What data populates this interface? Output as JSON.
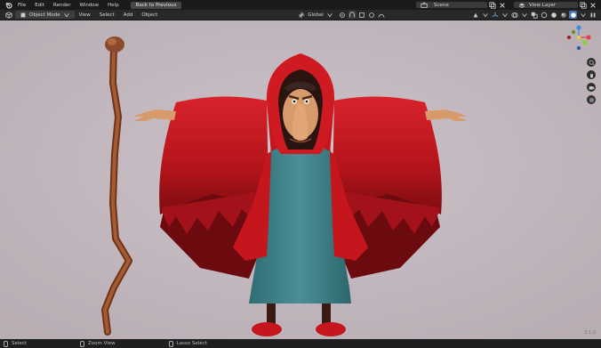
{
  "topbar": {
    "menus": [
      "File",
      "Edit",
      "Render",
      "Window",
      "Help"
    ],
    "back_button": "Back to Previous",
    "scene_label": "Scene",
    "view_layer_label": "View Layer"
  },
  "header": {
    "mode_label": "Object Mode",
    "menus": [
      "View",
      "Select",
      "Add",
      "Object"
    ],
    "transform_orientation": "Global"
  },
  "gizmo": {
    "axis_colors": {
      "x": "#e0424f",
      "y": "#8bcf3a",
      "z": "#3d8be3"
    }
  },
  "statusbar": {
    "items": [
      "Select",
      "Zoom View",
      "Lasso Select"
    ]
  },
  "version": "3.1.0",
  "colors": {
    "viewport_bg": "#c6b9c1",
    "cloak": "#c4161c",
    "dress": "#3d7f85",
    "staff": "#8b4a2b",
    "skin": "#d79a6a"
  }
}
